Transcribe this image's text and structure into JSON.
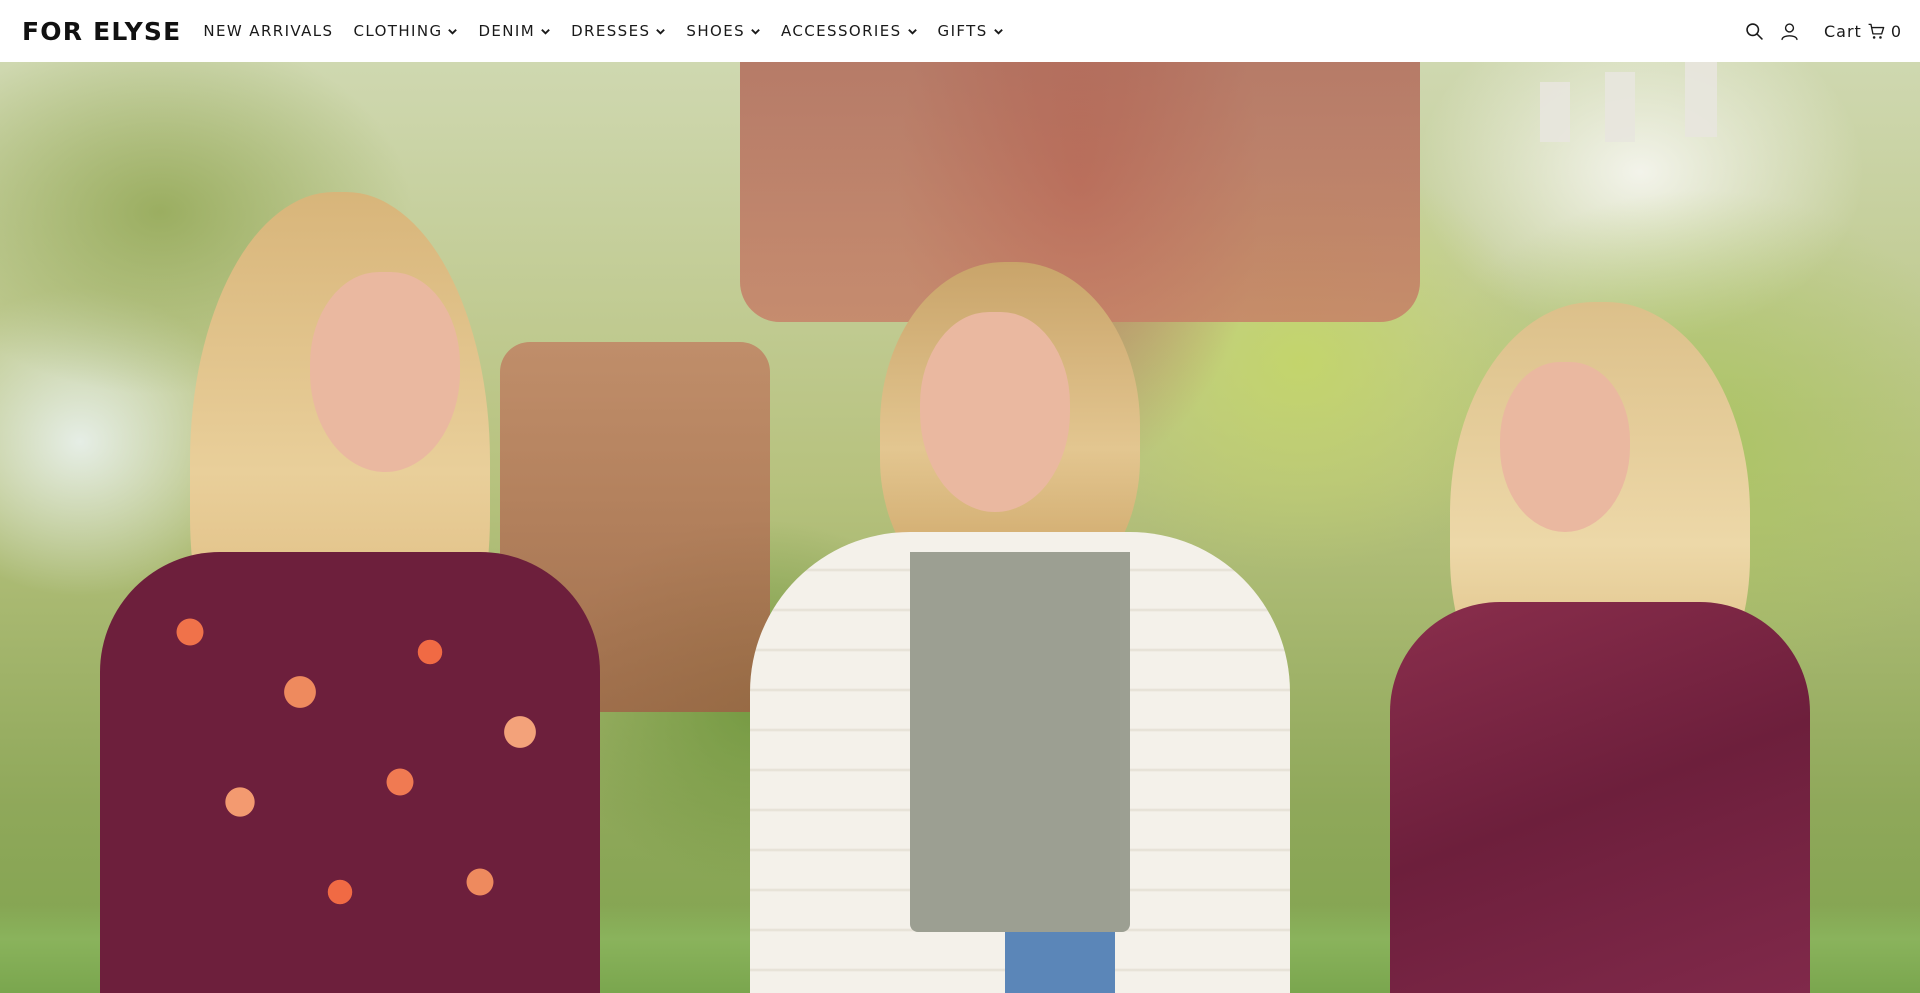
{
  "header": {
    "logo": "FOR ELYSE",
    "nav": [
      {
        "label": "NEW ARRIVALS",
        "has_dropdown": false
      },
      {
        "label": "CLOTHING",
        "has_dropdown": true
      },
      {
        "label": "DENIM",
        "has_dropdown": true
      },
      {
        "label": "DRESSES",
        "has_dropdown": true
      },
      {
        "label": "SHOES",
        "has_dropdown": true
      },
      {
        "label": "ACCESSORIES",
        "has_dropdown": true
      },
      {
        "label": "GIFTS",
        "has_dropdown": true
      }
    ],
    "tools": {
      "search_icon": "search-icon",
      "account_icon": "account-icon",
      "cart_label": "Cart",
      "cart_icon": "cart-icon",
      "cart_count": "0"
    }
  },
  "hero": {
    "image_subject": "three women smiling outdoors on a campus with trees and brick building"
  },
  "colors": {
    "header_bg": "#ffffff",
    "text": "#111111",
    "accent_burgundy": "#7a2438"
  }
}
